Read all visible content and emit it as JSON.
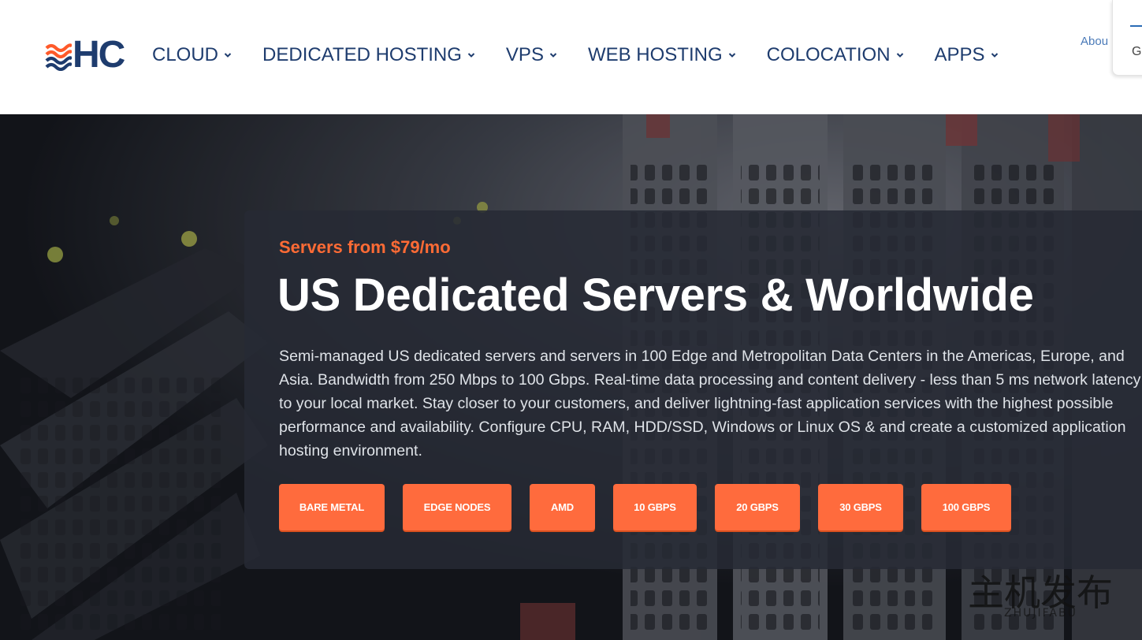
{
  "header": {
    "logo_text": "HC",
    "nav": [
      {
        "label": "CLOUD"
      },
      {
        "label": "DEDICATED HOSTING"
      },
      {
        "label": "VPS"
      },
      {
        "label": "WEB HOSTING"
      },
      {
        "label": "COLOCATION"
      },
      {
        "label": "APPS"
      }
    ],
    "about_label": "Abou",
    "corner_letter": "G"
  },
  "hero": {
    "eyebrow": "Servers from $79/mo",
    "headline": "US Dedicated Servers & Worldwide",
    "description": "Semi-managed US dedicated servers and servers in 100 Edge and Metropolitan Data Centers in the Americas, Europe, and Asia. Bandwidth from 250 Mbps to 100 Gbps. Real-time data processing and content delivery - less than 5 ms network latency to your local market. Stay closer to your customers, and deliver lightning-fast application services with the highest possible performance and availability. Configure CPU, RAM, HDD/SSD, Windows or Linux OS & and create a customized application hosting environment.",
    "buttons": [
      {
        "label": "BARE METAL"
      },
      {
        "label": "EDGE NODES"
      },
      {
        "label": "AMD"
      },
      {
        "label": "10 GBPS"
      },
      {
        "label": "20 GBPS"
      },
      {
        "label": "30 GBPS"
      },
      {
        "label": "100 GBPS"
      }
    ]
  },
  "colors": {
    "brand_navy": "#1e3c6e",
    "accent_orange": "#ff6b3d",
    "panel_bg": "#262a34"
  },
  "watermark_text": "主机发布 ZHUJIFABU"
}
